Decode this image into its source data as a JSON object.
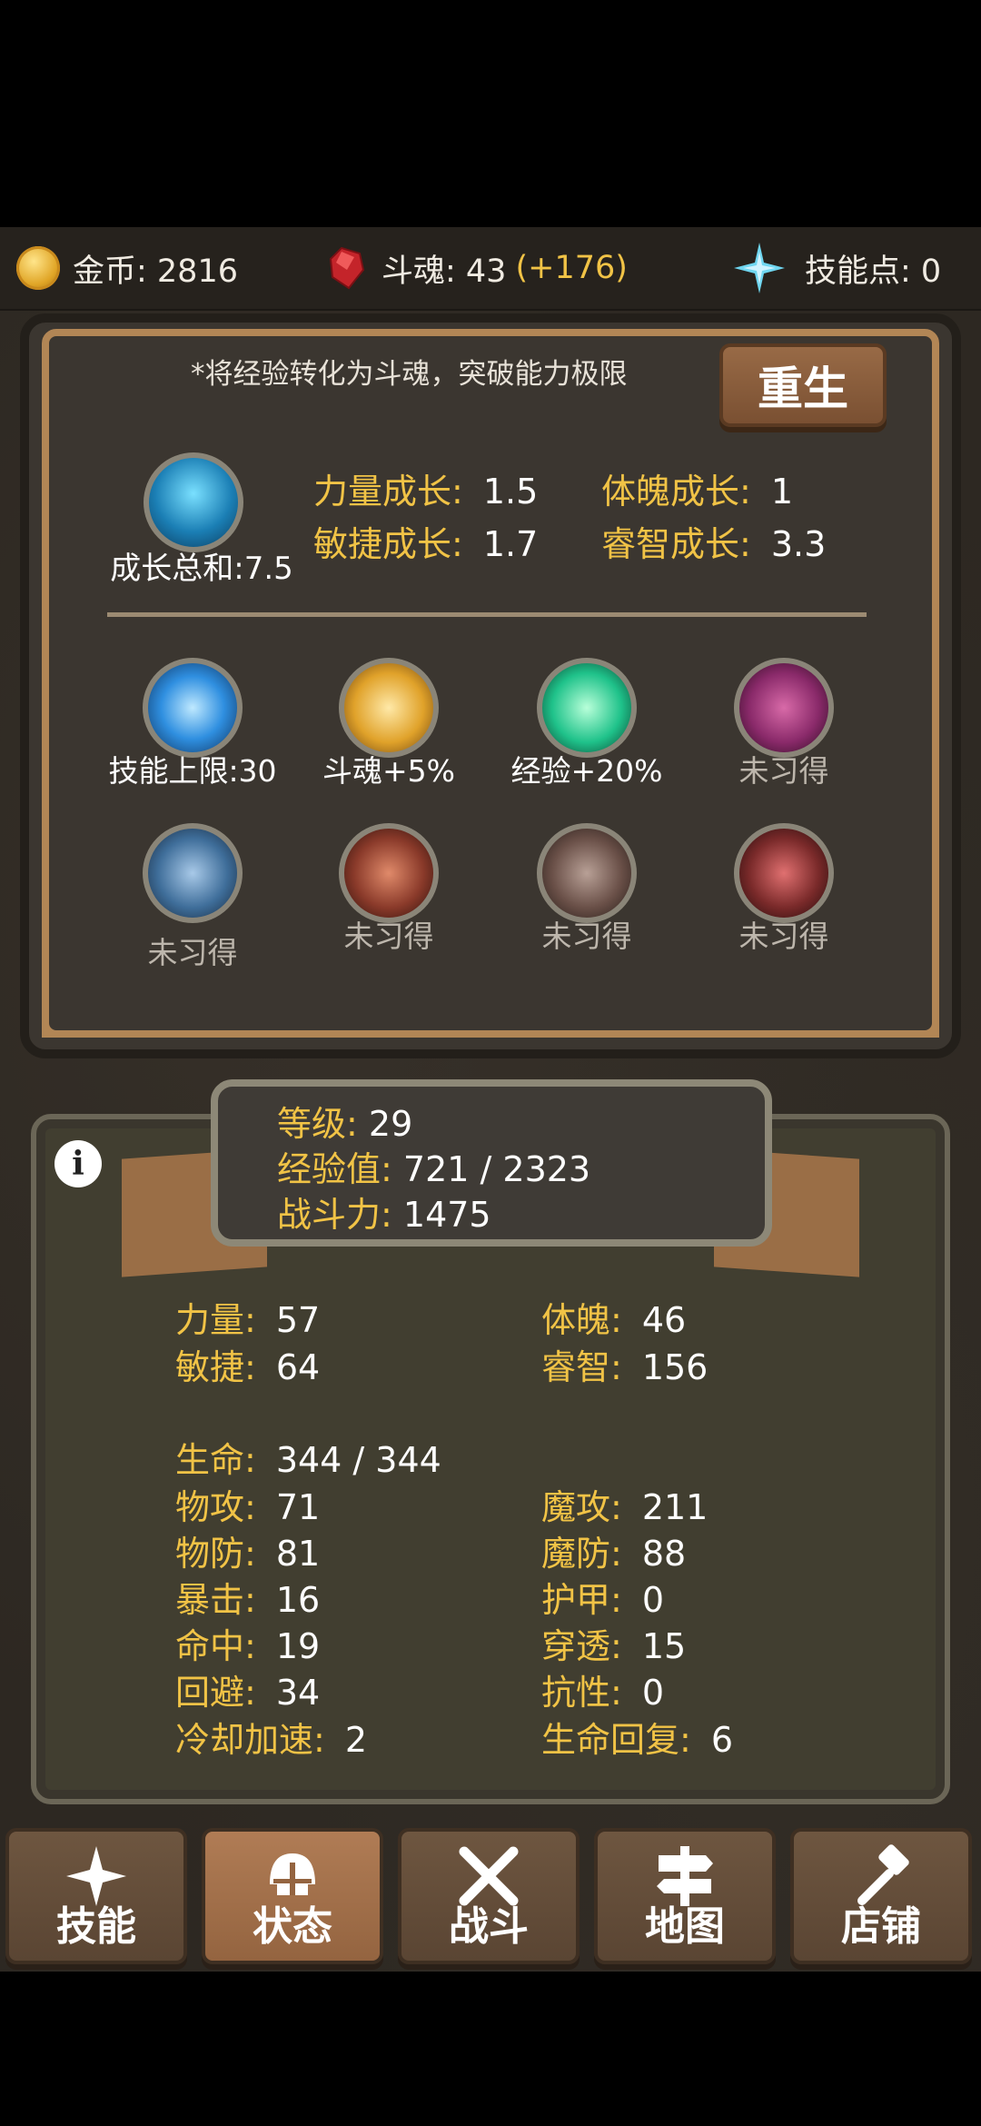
{
  "topbar": {
    "gold": "金币: 2816",
    "soul": "斗魂: 43",
    "soul_bonus": "(+176)",
    "skill_points": "技能点: 0"
  },
  "growth_panel": {
    "note": "*将经验转化为斗魂，突破能力极限",
    "rebirth_button": "重生",
    "growth_total": "成长总和:7.5",
    "growth": [
      {
        "label": "力量成长:",
        "value": "1.5"
      },
      {
        "label": "体魄成长:",
        "value": "1"
      },
      {
        "label": "敏捷成长:",
        "value": "1.7"
      },
      {
        "label": "睿智成长:",
        "value": "3.3"
      }
    ],
    "skills": [
      {
        "label": "技能上限:30",
        "icon": "blue-orb-icon",
        "color": "#2f8fe0"
      },
      {
        "label": "斗魂+5%",
        "icon": "golden-hand-icon",
        "color": "#e0a22a"
      },
      {
        "label": "经验+20%",
        "icon": "green-swirl-icon",
        "color": "#1fc28a"
      },
      {
        "label": "未习得",
        "icon": "purple-eye-icon",
        "color": "#8a2a6a"
      },
      {
        "label": "未习得",
        "icon": "scimitar-icon",
        "color": "#3f6e9a"
      },
      {
        "label": "未习得",
        "icon": "fire-warrior-icon",
        "color": "#8a3a2a"
      },
      {
        "label": "未习得",
        "icon": "horse-head-icon",
        "color": "#6a5048"
      },
      {
        "label": "未习得",
        "icon": "party-horn-icon",
        "color": "#7a2a2a"
      }
    ]
  },
  "summary": {
    "level_label": "等级:",
    "level": "29",
    "exp_label": "经验值:",
    "exp": "721 / 2323",
    "power_label": "战斗力:",
    "power": "1475"
  },
  "attributes": {
    "primary": [
      {
        "label": "力量:",
        "value": "57"
      },
      {
        "label": "体魄:",
        "value": "46"
      },
      {
        "label": "敏捷:",
        "value": "64"
      },
      {
        "label": "睿智:",
        "value": "156"
      }
    ],
    "hp_label": "生命:",
    "hp": "344 / 344",
    "secondary": [
      {
        "label": "物攻:",
        "value": "71"
      },
      {
        "label": "魔攻:",
        "value": "211"
      },
      {
        "label": "物防:",
        "value": "81"
      },
      {
        "label": "魔防:",
        "value": "88"
      },
      {
        "label": "暴击:",
        "value": "16"
      },
      {
        "label": "护甲:",
        "value": "0"
      },
      {
        "label": "命中:",
        "value": "19"
      },
      {
        "label": "穿透:",
        "value": "15"
      },
      {
        "label": "回避:",
        "value": "34"
      },
      {
        "label": "抗性:",
        "value": "0"
      },
      {
        "label": "冷却加速:",
        "value": "2"
      },
      {
        "label": "生命回复:",
        "value": "6"
      }
    ]
  },
  "nav": [
    {
      "label": "技能",
      "icon": "sparkle-icon"
    },
    {
      "label": "状态",
      "icon": "helmet-icon",
      "active": true
    },
    {
      "label": "战斗",
      "icon": "crossed-swords-icon"
    },
    {
      "label": "地图",
      "icon": "signpost-icon"
    },
    {
      "label": "店铺",
      "icon": "hammer-icon"
    }
  ],
  "colors": {
    "accent": "#f1c346",
    "frame": "#b28655",
    "button": "#7a5032"
  }
}
